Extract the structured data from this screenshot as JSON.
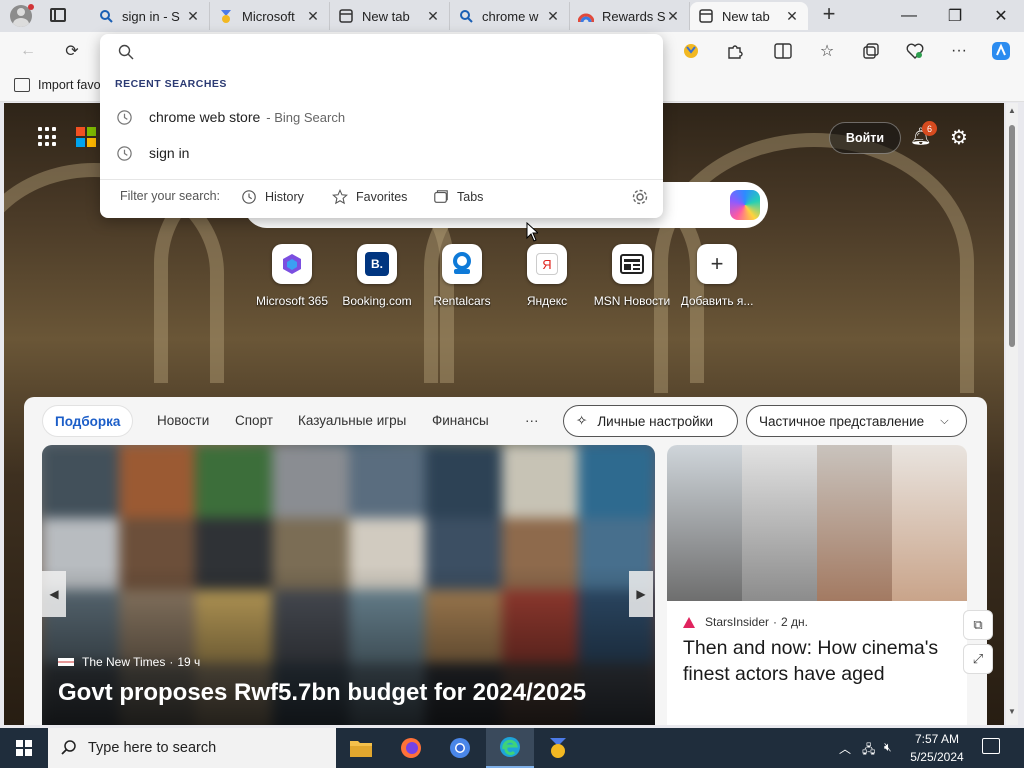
{
  "tabs": [
    {
      "title": "sign in - S",
      "icon": "bing-search-icon",
      "active": false
    },
    {
      "title": "Microsoft",
      "icon": "microsoft-rewards-icon",
      "active": false
    },
    {
      "title": "New tab",
      "icon": "new-tab-icon",
      "active": false
    },
    {
      "title": "chrome w",
      "icon": "bing-search-icon",
      "active": false
    },
    {
      "title": "Rewards S",
      "icon": "rewards-icon",
      "active": false
    },
    {
      "title": "New tab",
      "icon": "new-tab-icon",
      "active": true
    }
  ],
  "favorites_bar": {
    "import_label": "Import favo"
  },
  "search_dropdown": {
    "input_value": "",
    "heading": "RECENT SEARCHES",
    "items": [
      {
        "text": "chrome web store",
        "suffix": "- Bing Search"
      },
      {
        "text": "sign in",
        "suffix": ""
      }
    ],
    "filter_label": "Filter your search:",
    "chips": [
      "History",
      "Favorites",
      "Tabs"
    ]
  },
  "newtab": {
    "login_label": "Войти",
    "notification_count": "6",
    "tiles": [
      {
        "label": "Microsoft 365",
        "icon": "microsoft-365-icon"
      },
      {
        "label": "Booking.com",
        "icon": "booking-icon",
        "glyph": "B."
      },
      {
        "label": "Rentalcars",
        "icon": "rentalcars-icon"
      },
      {
        "label": "Яндекс",
        "icon": "yandex-icon",
        "glyph": "Я"
      },
      {
        "label": "MSN Новости",
        "icon": "msn-news-icon"
      },
      {
        "label": "Добавить я...",
        "icon": "add-icon",
        "glyph": "+"
      }
    ]
  },
  "feed": {
    "nav": [
      "Подборка",
      "Новости",
      "Спорт",
      "Казуальные игры",
      "Финансы",
      "···"
    ],
    "personalize_label": "Личные настройки",
    "view_label": "Частичное представление",
    "main_card": {
      "source": "The New Times",
      "age": "19 ч",
      "headline": "Govt proposes Rwf5.7bn budget for 2024/2025"
    },
    "side_card": {
      "source": "StarsInsider",
      "age": "2 дн.",
      "headline": "Then and now: How cinema's finest actors have aged"
    }
  },
  "taskbar": {
    "search_placeholder": "Type here to search",
    "time": "7:57 AM",
    "date": "5/25/2024"
  },
  "colors": {
    "accent": "#1c5ec8",
    "taskbar": "#1f2d3c",
    "badge": "#d64b1f"
  }
}
